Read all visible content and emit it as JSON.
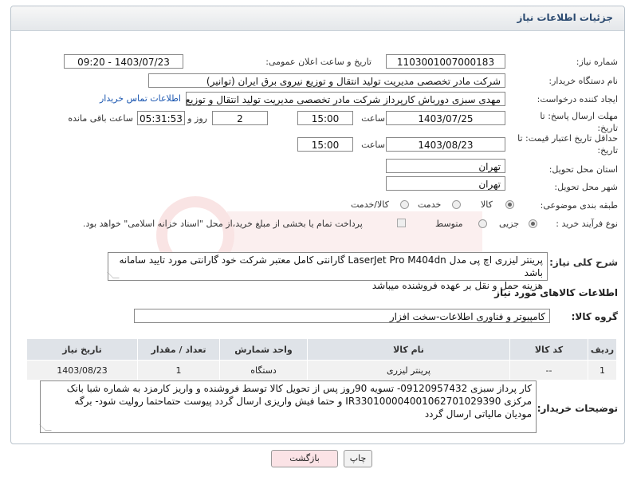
{
  "panel": {
    "title": "جزئیات اطلاعات نیاز"
  },
  "fields": {
    "need_number_label": "شماره نیاز:",
    "need_number": "1103001007000183",
    "announce_label": "تاریخ و ساعت اعلان عمومی:",
    "announce_value": "1403/07/23 - 09:20",
    "buyer_org_label": "نام دستگاه خریدار:",
    "buyer_org": "شرکت مادر تخصصی مدیریت تولید  انتقال و توزیع نیروی برق ایران (توانیر)",
    "creator_label": "ایجاد کننده درخواست:",
    "creator": "مهدی سبزی دورباش کارپرداز شرکت مادر تخصصی مدیریت تولید  انتقال و توزیع ن",
    "contact_link": "اطلاعات تماس خریدار",
    "deadline_label_1": "مهلت ارسال پاسخ: تا",
    "deadline_label_2": "تاریخ:",
    "deadline_date": "1403/07/25",
    "time_label": "ساعت",
    "deadline_time": "15:00",
    "days_value": "2",
    "days_label": "روز و",
    "remaining_time": "05:31:53",
    "remaining_label": "ساعت باقی مانده",
    "validity_label_1": "حداقل تاریخ اعتبار قیمت: تا",
    "validity_label_2": "تاریخ:",
    "validity_date": "1403/08/23",
    "validity_time": "15:00",
    "province_label": "استان محل تحویل:",
    "province": "تهران",
    "city_label": "شهر محل تحویل:",
    "city": "تهران",
    "category_label": "طبقه بندی موضوعی:",
    "category_options": [
      "کالا",
      "خدمت",
      "کالا/خدمت"
    ],
    "purchase_type_label": "نوع فرآیند خرید :",
    "purchase_options": [
      "جزیی",
      "متوسط"
    ],
    "payment_note": "پرداخت تمام یا بخشی از مبلغ خرید،از محل \"اسناد خزانه اسلامی\" خواهد بود.",
    "summary_label": "شرح کلی نیاز:",
    "summary_line1": "پرینتر لیزری اچ پی مدل LaserJet Pro M404dn گارانتی کامل معتبر شرکت خود گارانتی مورد تایید سامانه باشد",
    "summary_line2": "هزینه حمل و نقل بر عهده فروشنده میباشد"
  },
  "goods": {
    "section_title": "اطلاعات کالاهای مورد نیاز",
    "group_label": "گروه کالا:",
    "group_value": "کامپیوتر و فناوری اطلاعات-سخت افزار",
    "headers": [
      "ردیف",
      "کد کالا",
      "نام کالا",
      "واحد شمارش",
      "تعداد / مقدار",
      "تاریخ نیاز"
    ],
    "rows": [
      [
        "1",
        "--",
        "پرینتر لیزری",
        "دستگاه",
        "1",
        "1403/08/23"
      ]
    ]
  },
  "buyer_notes": {
    "label": "توضیحات خریدار:",
    "text": "کار پرداز سبزی 09120957432- تسویه 90روز پس از تحویل کالا توسط فروشنده و واریز کارمزد به شماره شبا بانک مرکزی IR330100004001062701029390 و حتما فیش واریزی ارسال گردد پیوست حتماحتما رولیت شود- برگه مودیان مالیاتی ارسال گردد"
  },
  "buttons": {
    "back": "بازگشت",
    "print": "چاپ"
  },
  "colors": {
    "title": "#2b4a70",
    "link": "#1a56b0",
    "back_button": "#fbe3e6"
  }
}
